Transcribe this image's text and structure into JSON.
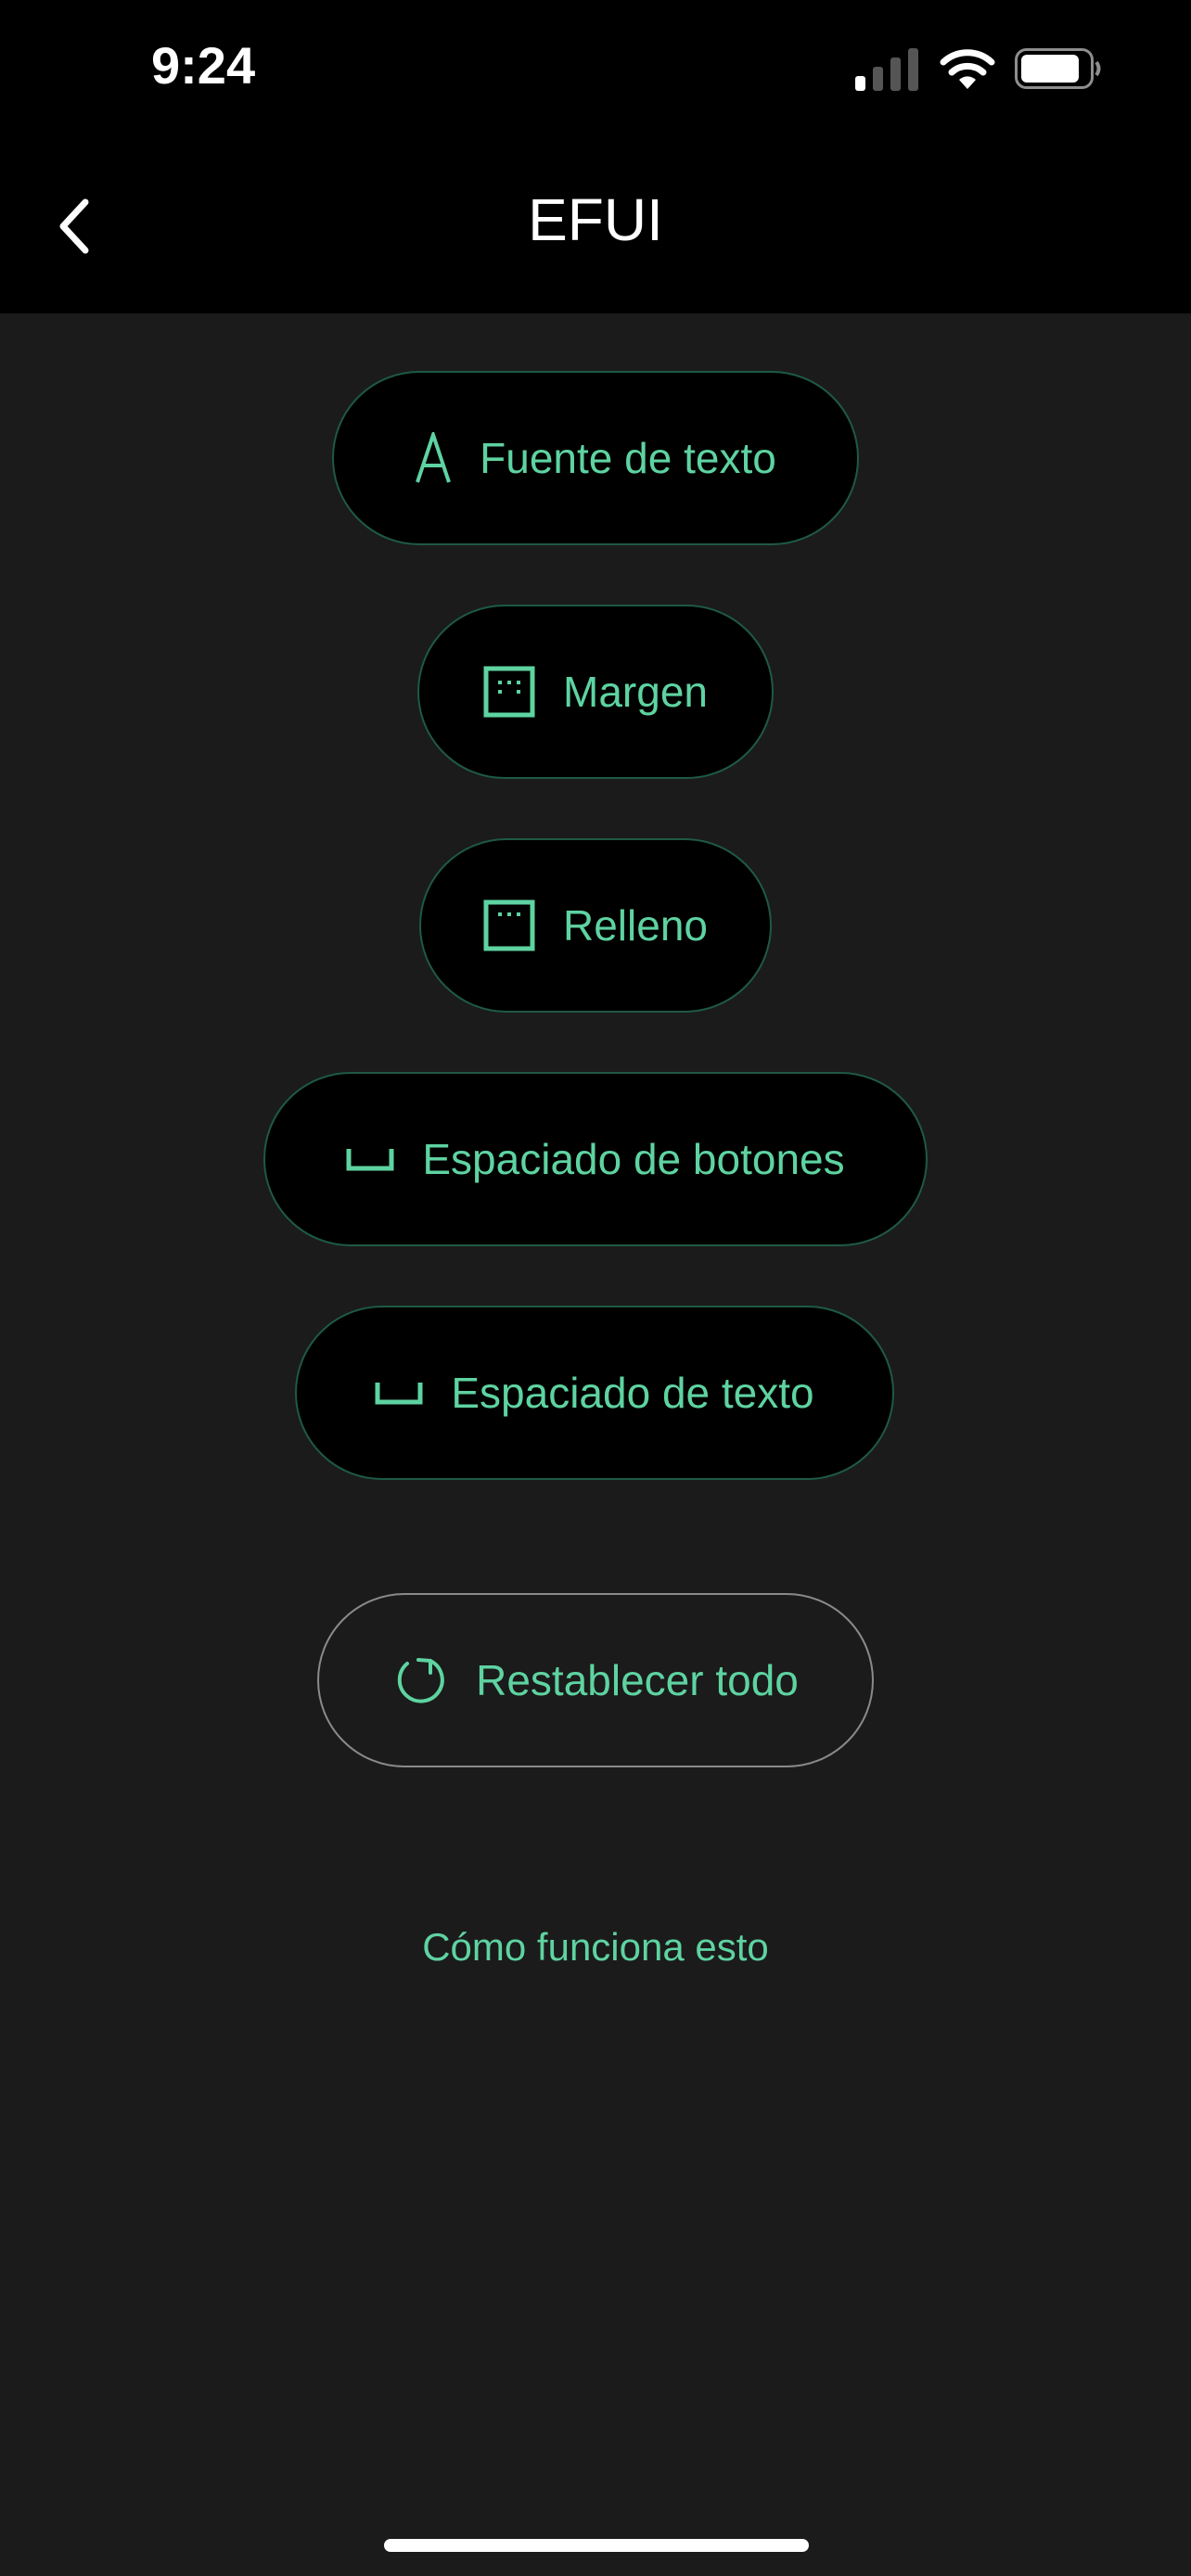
{
  "status_bar": {
    "time": "9:24",
    "icons": [
      "cellular-signal-icon",
      "wifi-icon",
      "battery-icon"
    ]
  },
  "nav": {
    "title": "EFUI",
    "back_icon": "chevron-left-icon"
  },
  "buttons": [
    {
      "label": "Fuente de texto",
      "icon": "letter-a-icon"
    },
    {
      "label": "Margen",
      "icon": "margin-icon"
    },
    {
      "label": "Relleno",
      "icon": "padding-icon"
    },
    {
      "label": "Espaciado de botones",
      "icon": "space-bracket-icon"
    },
    {
      "label": "Espaciado de texto",
      "icon": "space-bracket-icon"
    }
  ],
  "reset": {
    "label": "Restablecer todo",
    "icon": "refresh-icon"
  },
  "help_link": "Cómo funciona esto",
  "colors": {
    "accent": "#5ed3a1",
    "background": "#1b1b1b",
    "button_bg": "#000000",
    "button_border": "#1e5a43"
  }
}
